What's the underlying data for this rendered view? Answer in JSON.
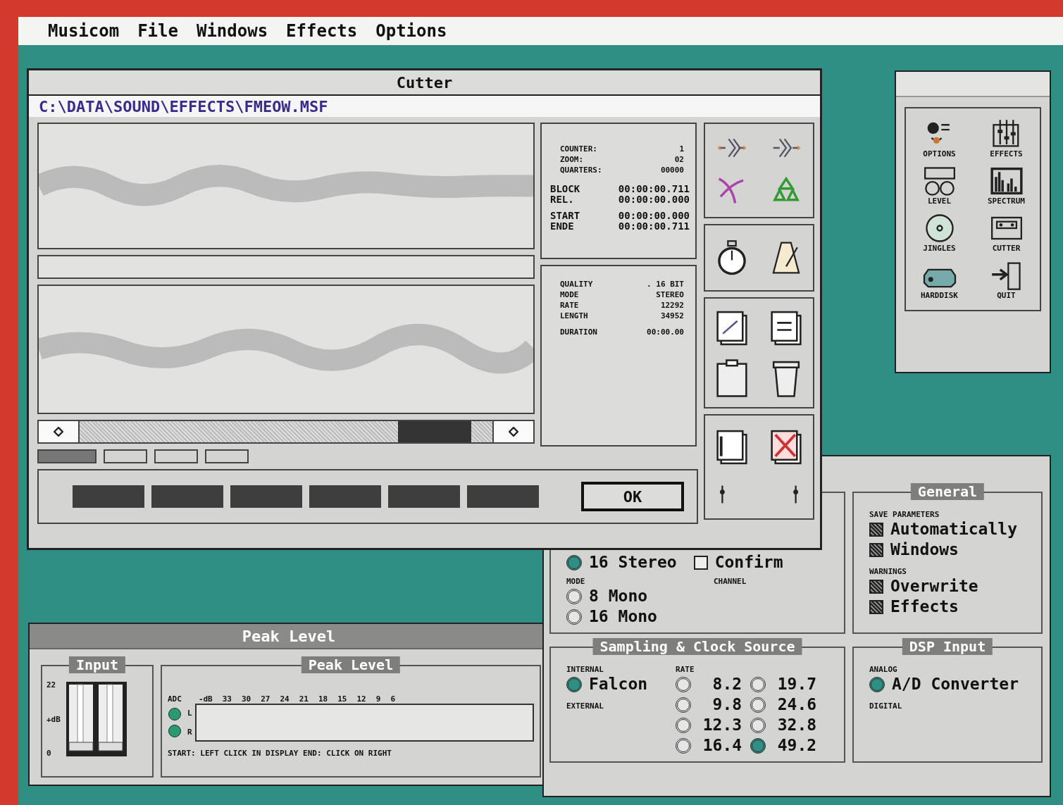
{
  "menu_bar": {
    "items": [
      "Musicom",
      "File",
      "Windows",
      "Effects",
      "Options"
    ]
  },
  "cutter": {
    "title": "Cutter",
    "path": "C:\\DATA\\SOUND\\EFFECTS\\FMEOW.MSF",
    "counters": [
      {
        "label": "COUNTER:",
        "value": "1"
      },
      {
        "label": "ZOOM:",
        "value": "02"
      },
      {
        "label": "QUARTERS:",
        "value": "00000"
      }
    ],
    "times": [
      {
        "label": "BLOCK",
        "value": "00:00:00.711"
      },
      {
        "label": "REL.",
        "value": "00:00:00.000"
      },
      {
        "label": "START",
        "value": "00:00:00.000"
      },
      {
        "label": "ENDE",
        "value": "00:00:00.711"
      }
    ],
    "info": [
      {
        "label": "QUALITY",
        "value": ".   16 BIT"
      },
      {
        "label": "MODE",
        "value": "STEREO"
      },
      {
        "label": "RATE",
        "value": "12292"
      },
      {
        "label": "LENGTH",
        "value": "34952"
      },
      {
        "label": "DURATION",
        "value": "00:00.00"
      }
    ],
    "ok": "OK"
  },
  "tools": {
    "items": [
      {
        "label": "OPTIONS"
      },
      {
        "label": "EFFECTS"
      },
      {
        "label": "LEVEL"
      },
      {
        "label": "SPECTRUM"
      },
      {
        "label": "JINGLES"
      },
      {
        "label": "CUTTER"
      },
      {
        "label": "HARDDISK"
      },
      {
        "label": "QUIT"
      }
    ]
  },
  "options": {
    "top": {
      "stereo": {
        "label": "16 Stereo",
        "selected": true
      },
      "confirm": {
        "label": "Confirm",
        "checked": false
      },
      "mode_label": "MODE",
      "modes": [
        {
          "label": "8 Mono",
          "selected": false
        },
        {
          "label": "16 Mono",
          "selected": false
        }
      ],
      "channel_label": "CHANNEL"
    },
    "general": {
      "title": "General",
      "save_label": "SAVE PARAMETERS",
      "save": [
        {
          "label": "Automatically",
          "checked": true
        },
        {
          "label": "Windows",
          "checked": true
        }
      ],
      "warnings_label": "WARNINGS",
      "warnings": [
        {
          "label": "Overwrite",
          "checked": true
        },
        {
          "label": "Effects",
          "checked": true
        }
      ]
    },
    "sampling": {
      "title": "Sampling & Clock Source",
      "internal_label": "INTERNAL",
      "internal": [
        {
          "label": "Falcon",
          "selected": true
        }
      ],
      "external_label": "EXTERNAL",
      "rate_label": "RATE",
      "rates": [
        {
          "label": "8.2",
          "selected": false
        },
        {
          "label": "19.7",
          "selected": false
        },
        {
          "label": "9.8",
          "selected": false
        },
        {
          "label": "24.6",
          "selected": false
        },
        {
          "label": "12.3",
          "selected": false
        },
        {
          "label": "32.8",
          "selected": false
        },
        {
          "label": "16.4",
          "selected": false
        },
        {
          "label": "49.2",
          "selected": true
        }
      ]
    },
    "dsp": {
      "title": "DSP Input",
      "analog_label": "ANALOG",
      "analog": [
        {
          "label": "A/D Converter",
          "selected": true
        }
      ],
      "digital_label": "DIGITAL"
    }
  },
  "peak": {
    "title": "Peak Level",
    "input_title": "Input",
    "input_scale": [
      "22",
      "+dB",
      "0"
    ],
    "meter_title": "Peak Level",
    "adc_label": "ADC",
    "channels": [
      "L",
      "R"
    ],
    "scale": [
      "-dB",
      "33",
      "30",
      "27",
      "24",
      "21",
      "18",
      "15",
      "12",
      "9",
      "6"
    ],
    "hint": "START: LEFT CLICK IN DISPLAY END: CLICK ON RIGHT"
  }
}
